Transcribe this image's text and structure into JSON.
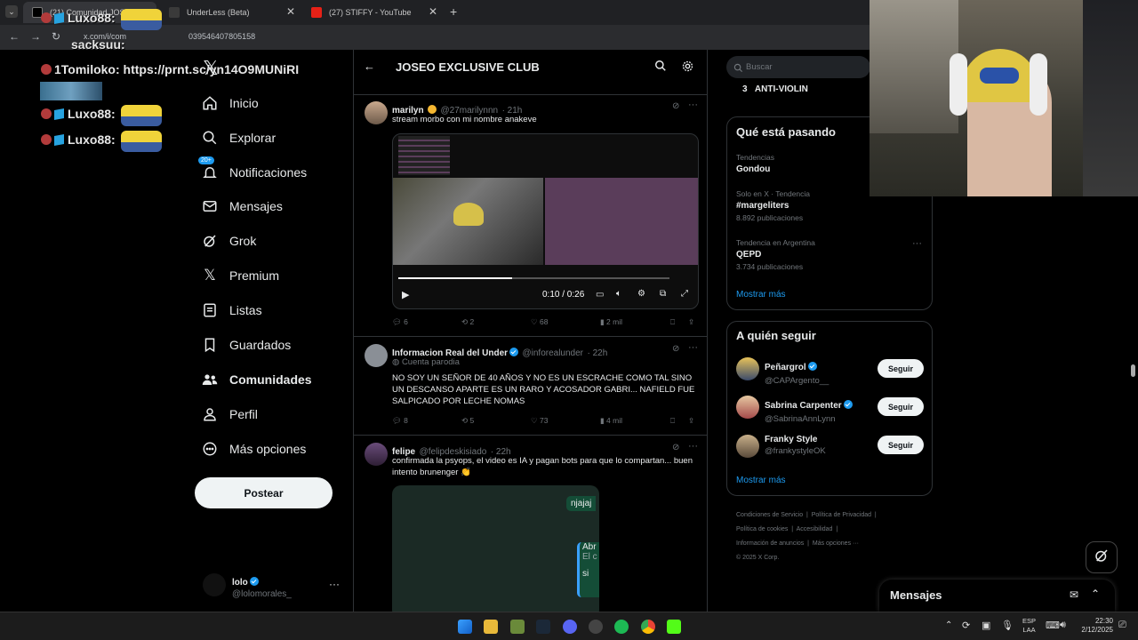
{
  "browser": {
    "tabs": [
      {
        "label": "(21) Comunidad JOSEO E"
      },
      {
        "label": "UnderLess (Beta)"
      },
      {
        "label": "(27) STIFFY - YouTube"
      }
    ],
    "url": "x.com/i/com",
    "url_tail": "039546407805158"
  },
  "overlay": {
    "chat": [
      {
        "user": "Luxo88:",
        "text": ""
      },
      {
        "user": "sacksuu:",
        "text": ""
      },
      {
        "user": "1Tomiloko:",
        "text": "https://prnt.sc/yn14O9MUNiRI"
      },
      {
        "user": "Luxo88:",
        "text": ""
      },
      {
        "user": "Luxo88:",
        "text": ""
      }
    ]
  },
  "nav": {
    "items": [
      {
        "label": "Inicio",
        "icon": "home-icon"
      },
      {
        "label": "Explorar",
        "icon": "search-icon"
      },
      {
        "label": "Notificaciones",
        "icon": "bell-icon",
        "badge": "20+"
      },
      {
        "label": "Mensajes",
        "icon": "mail-icon"
      },
      {
        "label": "Grok",
        "icon": "grok-icon"
      },
      {
        "label": "Premium",
        "icon": "x-logo-icon"
      },
      {
        "label": "Listas",
        "icon": "list-icon"
      },
      {
        "label": "Guardados",
        "icon": "bookmark-icon"
      },
      {
        "label": "Comunidades",
        "icon": "communities-icon"
      },
      {
        "label": "Perfil",
        "icon": "person-icon"
      },
      {
        "label": "Más opciones",
        "icon": "more-circle-icon"
      }
    ],
    "post_label": "Postear",
    "account": {
      "name": "lolo",
      "handle": "@lolomorales_"
    }
  },
  "header": {
    "title": "JOSEO EXCLUSIVE CLUB"
  },
  "tweets": [
    {
      "name": "marilyn",
      "handle": "@27marilynnn",
      "time": "· 21h",
      "text": "stream morbo con mi nombre anakeve",
      "video_time": "0:10 / 0:26",
      "replies": "6",
      "reposts": "2",
      "likes": "68",
      "views": "2 mil",
      "video_progress": 0.42
    },
    {
      "name": "Informacion Real del Under",
      "handle": "@inforealunder",
      "time": "· 22h",
      "parody": "Cuenta parodia",
      "text": "NO SOY UN SEÑOR DE 40 AÑOS Y NO ES UN ESCRACHE COMO TAL SINO UN DESCANSO APARTE ES UN RARO Y ACOSADOR GABRI... NAFIELD FUE SALPICADO POR LECHE NOMAS",
      "replies": "8",
      "reposts": "5",
      "likes": "73",
      "views": "4 mil"
    },
    {
      "name": "felipe",
      "handle": "@felipdeskisiado",
      "time": "· 22h",
      "text": "confirmada la psyops, el video es IA y pagan bots para que lo compartan... buen intento brunenger 👏",
      "img_texts": [
        "njajaj",
        "Abr",
        "El c",
        "si"
      ]
    }
  ],
  "right": {
    "search_placeholder": "Buscar",
    "trend_top": {
      "rank": "3",
      "label": "ANTI-VIOLIN"
    },
    "trends_title": "Qué está pasando",
    "trends": [
      {
        "context": "Tendencias",
        "name": "Gondou",
        "count": ""
      },
      {
        "context": "Solo en X · Tendencia",
        "name": "#margeliters",
        "count": "8.892 publicaciones"
      },
      {
        "context": "Tendencia en Argentina",
        "name": "QEPD",
        "count": "3.734 publicaciones"
      }
    ],
    "show_more": "Mostrar más",
    "follow_title": "A quién seguir",
    "follow": [
      {
        "name": "Peñargrol",
        "handle": "@CAPArgento__",
        "btn": "Seguir"
      },
      {
        "name": "Sabrina Carpenter",
        "handle": "@SabrinaAnnLynn",
        "btn": "Seguir"
      },
      {
        "name": "Franky Style",
        "handle": "@frankystyleOK",
        "btn": "Seguir"
      }
    ],
    "footer": [
      "Condiciones de Servicio",
      "Política de Privacidad",
      "Política de cookies",
      "Accesibilidad",
      "Información de anuncios",
      "Más opciones ···",
      "© 2025 X Corp."
    ],
    "messages": "Mensajes"
  },
  "taskbar": {
    "lang1": "ESP",
    "lang2": "LAA",
    "time": "22:30",
    "date": "2/12/2025"
  }
}
